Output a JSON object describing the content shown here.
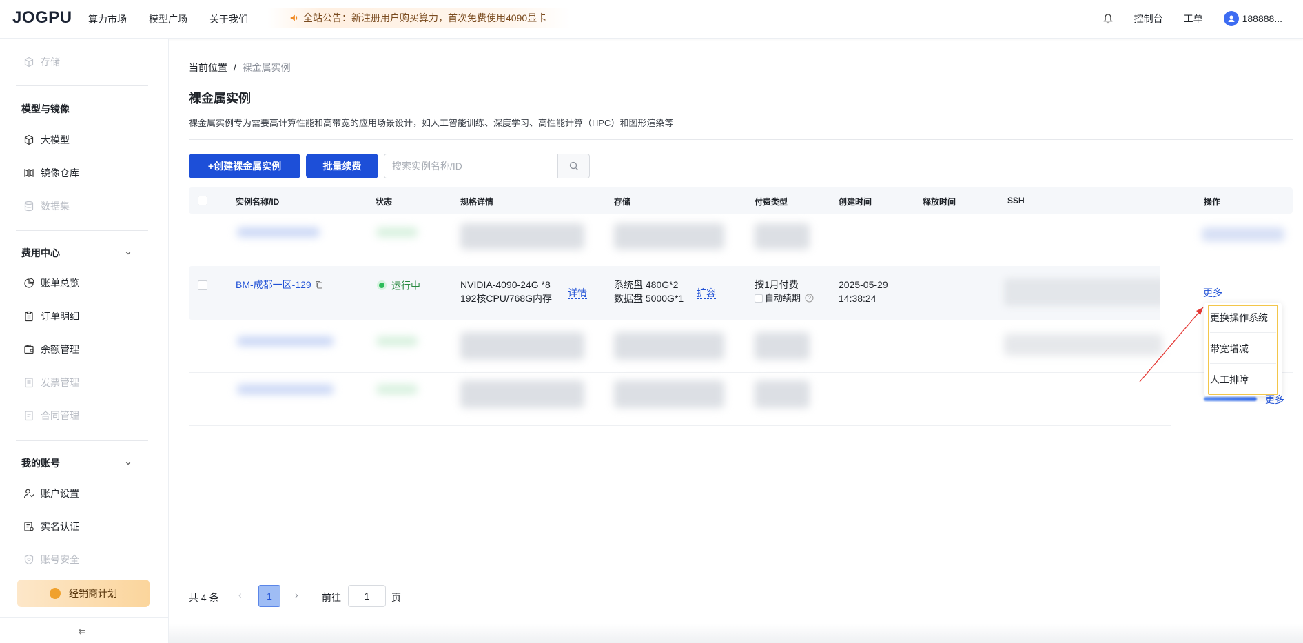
{
  "header": {
    "logo": "JOGPU",
    "nav": [
      "算力市场",
      "模型广场",
      "关于我们"
    ],
    "notice": "全站公告：新注册用户购买算力，首次免费使用4090显卡",
    "console": "控制台",
    "ticket": "工单",
    "username": "188888..."
  },
  "sidebar": {
    "storage": "存储",
    "group_model": "模型与镜像",
    "llm": "大模型",
    "image_repo": "镜像仓库",
    "dataset": "数据集",
    "group_billing": "费用中心",
    "bill_overview": "账单总览",
    "order_detail": "订单明细",
    "balance": "余额管理",
    "invoice": "发票管理",
    "contract": "合同管理",
    "group_account": "我的账号",
    "account_settings": "账户设置",
    "realname": "实名认证",
    "security": "账号安全",
    "dealer": "经销商计划"
  },
  "breadcrumb": {
    "prefix": "当前位置",
    "sep": "/",
    "current": "裸金属实例"
  },
  "page": {
    "title": "裸金属实例",
    "desc": "裸金属实例专为需要高计算性能和高带宽的应用场景设计，如人工智能训练、深度学习、高性能计算（HPC）和图形渲染等"
  },
  "toolbar": {
    "create": "+创建裸金属实例",
    "renew": "批量续费",
    "search_placeholder": "搜索实例名称/ID"
  },
  "table": {
    "headers": [
      "实例名称/ID",
      "状态",
      "规格详情",
      "存储",
      "付费类型",
      "创建时间",
      "释放时间",
      "SSH",
      "操作"
    ],
    "row": {
      "name": "BM-成都一区-129",
      "status": "运行中",
      "spec_line1": "NVIDIA-4090-24G *8",
      "spec_line2": "192核CPU/768G内存",
      "detail": "详情",
      "storage_line1": "系统盘 480G*2",
      "storage_line2": "数据盘 5000G*1",
      "expand": "扩容",
      "pay_type": "按1月付费",
      "auto_renew": "自动续期",
      "created_date": "2025-05-29",
      "created_time": "14:38:24",
      "more": "更多"
    },
    "more_bottom": "更多"
  },
  "dropdown": [
    "更换操作系统",
    "带宽增减",
    "人工排障"
  ],
  "pagination": {
    "total": "共 4 条",
    "current_page": "1",
    "goto": "前往",
    "goto_value": "1",
    "unit": "页"
  },
  "colors": {
    "primary": "#1d4fd8",
    "link": "#2152d6",
    "running": "#2dbc5a",
    "highlight": "#f3c64a",
    "arrow": "#e53935"
  }
}
